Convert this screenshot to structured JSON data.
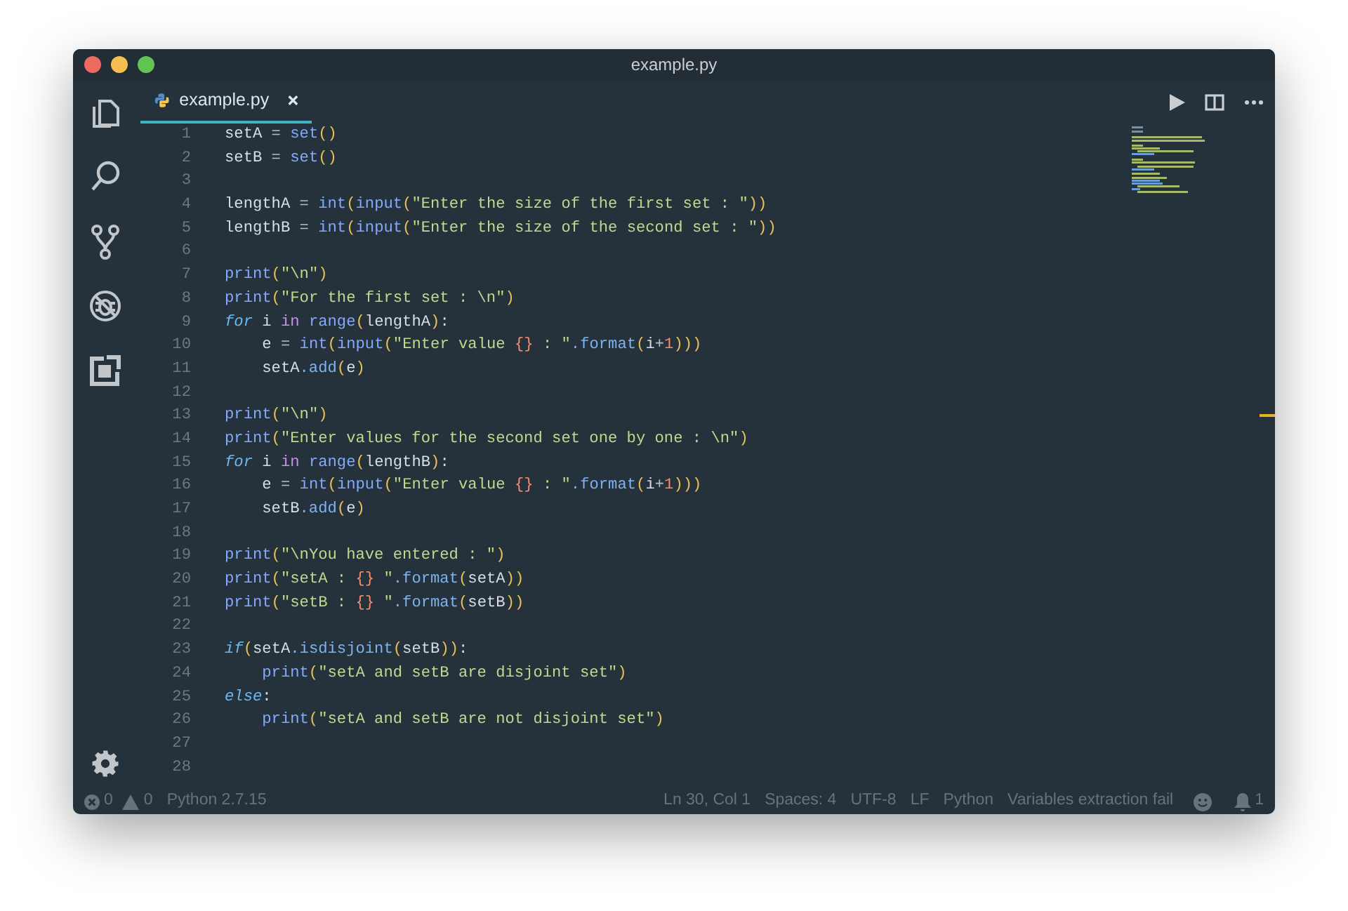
{
  "window": {
    "title": "example.py"
  },
  "tabs": [
    {
      "label": "example.py",
      "selected": true
    }
  ],
  "editor": {
    "lines": [
      {
        "number": "1",
        "tokens": [
          {
            "kind": "var",
            "text": "setA"
          },
          {
            "kind": "op",
            "text": " = "
          },
          {
            "kind": "fn",
            "text": "set"
          },
          {
            "kind": "paren",
            "text": "()"
          }
        ]
      },
      {
        "number": "2",
        "tokens": [
          {
            "kind": "var",
            "text": "setB"
          },
          {
            "kind": "op",
            "text": " = "
          },
          {
            "kind": "fn",
            "text": "set"
          },
          {
            "kind": "paren",
            "text": "()"
          }
        ]
      },
      {
        "number": "3"
      },
      {
        "number": "4",
        "tokens": [
          {
            "kind": "var",
            "text": "lengthA"
          },
          {
            "kind": "op",
            "text": " = "
          },
          {
            "kind": "fn",
            "text": "int"
          },
          {
            "kind": "paren",
            "text": "("
          },
          {
            "kind": "fn",
            "text": "input"
          },
          {
            "kind": "paren",
            "text": "("
          },
          {
            "kind": "str",
            "text": "\"Enter the size of the first set : \""
          },
          {
            "kind": "paren",
            "text": "))"
          }
        ]
      },
      {
        "number": "5",
        "tokens": [
          {
            "kind": "var",
            "text": "lengthB"
          },
          {
            "kind": "op",
            "text": " = "
          },
          {
            "kind": "fn",
            "text": "int"
          },
          {
            "kind": "paren",
            "text": "("
          },
          {
            "kind": "fn",
            "text": "input"
          },
          {
            "kind": "paren",
            "text": "("
          },
          {
            "kind": "str",
            "text": "\"Enter the size of the second set : \""
          },
          {
            "kind": "paren",
            "text": "))"
          }
        ]
      },
      {
        "number": "6"
      },
      {
        "number": "7",
        "tokens": [
          {
            "kind": "fn",
            "text": "print"
          },
          {
            "kind": "paren",
            "text": "("
          },
          {
            "kind": "str",
            "text": "\"\\n\""
          },
          {
            "kind": "paren",
            "text": ")"
          }
        ]
      },
      {
        "number": "8",
        "tokens": [
          {
            "kind": "fn",
            "text": "print"
          },
          {
            "kind": "paren",
            "text": "("
          },
          {
            "kind": "str",
            "text": "\"For the first set : \\n\""
          },
          {
            "kind": "paren",
            "text": ")"
          }
        ]
      },
      {
        "number": "9",
        "tokens": [
          {
            "kind": "kw",
            "text": "for"
          },
          {
            "kind": "var",
            "text": " i "
          },
          {
            "kind": "in",
            "text": "in"
          },
          {
            "kind": "fn",
            "text": " range"
          },
          {
            "kind": "paren",
            "text": "("
          },
          {
            "kind": "var",
            "text": "lengthA"
          },
          {
            "kind": "paren",
            "text": ")"
          },
          {
            "kind": "var",
            "text": ":"
          }
        ]
      },
      {
        "number": "10",
        "tokens": [
          {
            "kind": "var",
            "text": "    e"
          },
          {
            "kind": "op",
            "text": " = "
          },
          {
            "kind": "fn",
            "text": "int"
          },
          {
            "kind": "paren",
            "text": "("
          },
          {
            "kind": "fn",
            "text": "input"
          },
          {
            "kind": "paren",
            "text": "("
          },
          {
            "kind": "str",
            "text": "\"Enter value "
          },
          {
            "kind": "num",
            "text": "{}"
          },
          {
            "kind": "str",
            "text": " : \""
          },
          {
            "kind": "method",
            "text": ".format"
          },
          {
            "kind": "paren",
            "text": "("
          },
          {
            "kind": "var",
            "text": "i"
          },
          {
            "kind": "op",
            "text": "+"
          },
          {
            "kind": "num",
            "text": "1"
          },
          {
            "kind": "paren",
            "text": ")))"
          }
        ]
      },
      {
        "number": "11",
        "tokens": [
          {
            "kind": "var",
            "text": "    setA"
          },
          {
            "kind": "method",
            "text": ".add"
          },
          {
            "kind": "paren",
            "text": "("
          },
          {
            "kind": "var",
            "text": "e"
          },
          {
            "kind": "paren",
            "text": ")"
          }
        ]
      },
      {
        "number": "12"
      },
      {
        "number": "13",
        "tokens": [
          {
            "kind": "fn",
            "text": "print"
          },
          {
            "kind": "paren",
            "text": "("
          },
          {
            "kind": "str",
            "text": "\"\\n\""
          },
          {
            "kind": "paren",
            "text": ")"
          }
        ]
      },
      {
        "number": "14",
        "tokens": [
          {
            "kind": "fn",
            "text": "print"
          },
          {
            "kind": "paren",
            "text": "("
          },
          {
            "kind": "str",
            "text": "\"Enter values for the second set one by one : \\n\""
          },
          {
            "kind": "paren",
            "text": ")"
          }
        ]
      },
      {
        "number": "15",
        "tokens": [
          {
            "kind": "kw",
            "text": "for"
          },
          {
            "kind": "var",
            "text": " i "
          },
          {
            "kind": "in",
            "text": "in"
          },
          {
            "kind": "fn",
            "text": " range"
          },
          {
            "kind": "paren",
            "text": "("
          },
          {
            "kind": "var",
            "text": "lengthB"
          },
          {
            "kind": "paren",
            "text": ")"
          },
          {
            "kind": "var",
            "text": ":"
          }
        ]
      },
      {
        "number": "16",
        "tokens": [
          {
            "kind": "var",
            "text": "    e"
          },
          {
            "kind": "op",
            "text": " = "
          },
          {
            "kind": "fn",
            "text": "int"
          },
          {
            "kind": "paren",
            "text": "("
          },
          {
            "kind": "fn",
            "text": "input"
          },
          {
            "kind": "paren",
            "text": "("
          },
          {
            "kind": "str",
            "text": "\"Enter value "
          },
          {
            "kind": "num",
            "text": "{}"
          },
          {
            "kind": "str",
            "text": " : \""
          },
          {
            "kind": "method",
            "text": ".format"
          },
          {
            "kind": "paren",
            "text": "("
          },
          {
            "kind": "var",
            "text": "i"
          },
          {
            "kind": "op",
            "text": "+"
          },
          {
            "kind": "num",
            "text": "1"
          },
          {
            "kind": "paren",
            "text": ")))"
          }
        ]
      },
      {
        "number": "17",
        "tokens": [
          {
            "kind": "var",
            "text": "    setB"
          },
          {
            "kind": "method",
            "text": ".add"
          },
          {
            "kind": "paren",
            "text": "("
          },
          {
            "kind": "var",
            "text": "e"
          },
          {
            "kind": "paren",
            "text": ")"
          }
        ]
      },
      {
        "number": "18"
      },
      {
        "number": "19",
        "tokens": [
          {
            "kind": "fn",
            "text": "print"
          },
          {
            "kind": "paren",
            "text": "("
          },
          {
            "kind": "str",
            "text": "\"\\nYou have entered : \""
          },
          {
            "kind": "paren",
            "text": ")"
          }
        ]
      },
      {
        "number": "20",
        "tokens": [
          {
            "kind": "fn",
            "text": "print"
          },
          {
            "kind": "paren",
            "text": "("
          },
          {
            "kind": "str",
            "text": "\"setA : "
          },
          {
            "kind": "num",
            "text": "{}"
          },
          {
            "kind": "str",
            "text": " \""
          },
          {
            "kind": "method",
            "text": ".format"
          },
          {
            "kind": "paren",
            "text": "("
          },
          {
            "kind": "var",
            "text": "setA"
          },
          {
            "kind": "paren",
            "text": "))"
          }
        ]
      },
      {
        "number": "21",
        "tokens": [
          {
            "kind": "fn",
            "text": "print"
          },
          {
            "kind": "paren",
            "text": "("
          },
          {
            "kind": "str",
            "text": "\"setB : "
          },
          {
            "kind": "num",
            "text": "{}"
          },
          {
            "kind": "str",
            "text": " \""
          },
          {
            "kind": "method",
            "text": ".format"
          },
          {
            "kind": "paren",
            "text": "("
          },
          {
            "kind": "var",
            "text": "setB"
          },
          {
            "kind": "paren",
            "text": "))"
          }
        ]
      },
      {
        "number": "22"
      },
      {
        "number": "23",
        "tokens": [
          {
            "kind": "kw",
            "text": "if"
          },
          {
            "kind": "paren",
            "text": "("
          },
          {
            "kind": "var",
            "text": "setA"
          },
          {
            "kind": "method",
            "text": ".isdisjoint"
          },
          {
            "kind": "paren",
            "text": "("
          },
          {
            "kind": "var",
            "text": "setB"
          },
          {
            "kind": "paren",
            "text": "))"
          },
          {
            "kind": "var",
            "text": ":"
          }
        ]
      },
      {
        "number": "24",
        "tokens": [
          {
            "kind": "fn",
            "text": "    print"
          },
          {
            "kind": "paren",
            "text": "("
          },
          {
            "kind": "str",
            "text": "\"setA and setB are disjoint set\""
          },
          {
            "kind": "paren",
            "text": ")"
          }
        ]
      },
      {
        "number": "25",
        "tokens": [
          {
            "kind": "kw",
            "text": "else"
          },
          {
            "kind": "var",
            "text": ":"
          }
        ]
      },
      {
        "number": "26",
        "tokens": [
          {
            "kind": "fn",
            "text": "    print"
          },
          {
            "kind": "paren",
            "text": "("
          },
          {
            "kind": "str",
            "text": "\"setA and setB are not disjoint set\""
          },
          {
            "kind": "paren",
            "text": ")"
          }
        ]
      },
      {
        "number": "27"
      },
      {
        "number": "28"
      }
    ]
  },
  "status_bar": {
    "errors": "0",
    "warnings": "0",
    "interpreter": "Python 2.7.15",
    "items": [
      "Ln 30, Col 1",
      "Spaces: 4",
      "UTF-8",
      "LF",
      "Python",
      "Variables extraction fail"
    ],
    "notifications": "1"
  }
}
